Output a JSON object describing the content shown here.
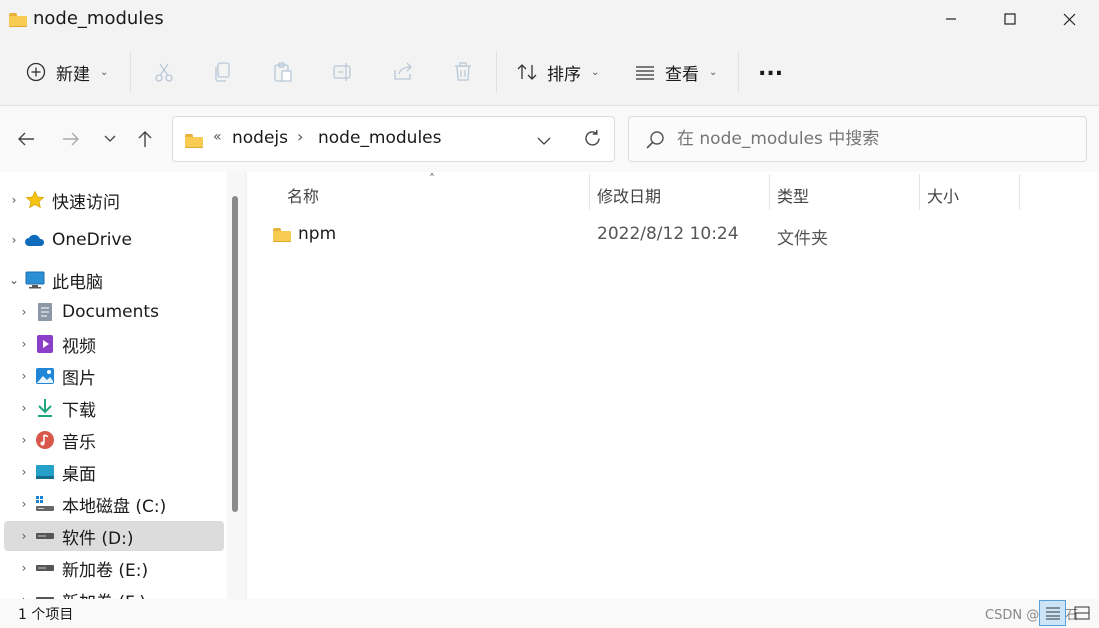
{
  "window": {
    "title": "node_modules"
  },
  "toolbar": {
    "new_label": "新建",
    "sort_label": "排序",
    "view_label": "查看",
    "more_label": "..."
  },
  "address": {
    "overflow": "«",
    "crumbs": [
      "nodejs",
      "node_modules"
    ]
  },
  "search": {
    "placeholder": "在 node_modules 中搜索"
  },
  "nav_tree": [
    {
      "label": "快速访问",
      "icon": "star-icon",
      "level": 0
    },
    {
      "label": "OneDrive",
      "icon": "cloud-icon",
      "level": 0
    },
    {
      "label": "此电脑",
      "icon": "computer-icon",
      "level": 0,
      "expanded": true
    },
    {
      "label": "Documents",
      "icon": "document-icon",
      "level": 1
    },
    {
      "label": "视频",
      "icon": "video-icon",
      "level": 1
    },
    {
      "label": "图片",
      "icon": "picture-icon",
      "level": 1
    },
    {
      "label": "下载",
      "icon": "download-icon",
      "level": 1
    },
    {
      "label": "音乐",
      "icon": "music-icon",
      "level": 1
    },
    {
      "label": "桌面",
      "icon": "desktop-icon",
      "level": 1
    },
    {
      "label": "本地磁盘 (C:)",
      "icon": "system-drive-icon",
      "level": 1
    },
    {
      "label": "软件 (D:)",
      "icon": "drive-icon",
      "level": 1,
      "selected": true
    },
    {
      "label": "新加卷 (E:)",
      "icon": "drive-icon",
      "level": 1
    },
    {
      "label": "新加卷 (F:)",
      "icon": "drive-icon",
      "level": 1
    }
  ],
  "columns": {
    "name": "名称",
    "modified": "修改日期",
    "type": "类型",
    "size": "大小"
  },
  "files": [
    {
      "name": "npm",
      "modified": "2022/8/12 10:24",
      "type": "文件夹",
      "size": ""
    }
  ],
  "status": {
    "count": "1 个项目"
  },
  "watermark": "CSDN @任住石"
}
